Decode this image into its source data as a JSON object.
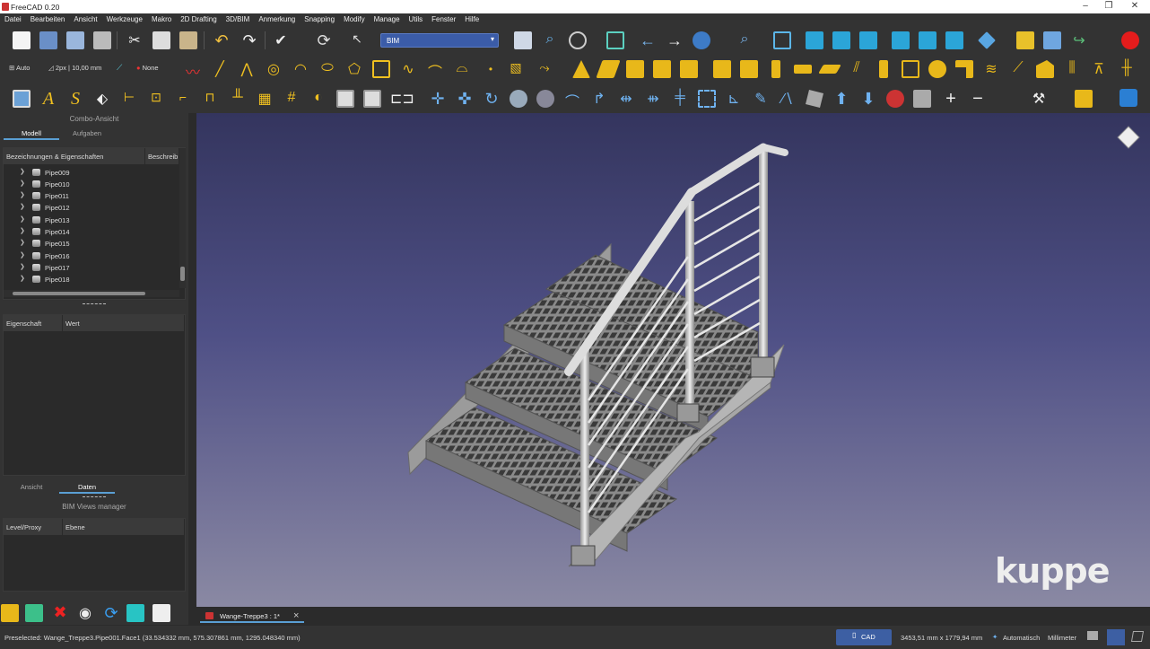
{
  "titlebar": {
    "title": "FreeCAD 0.20",
    "min": "–",
    "max": "❐",
    "close": "✕"
  },
  "menu": [
    "Datei",
    "Bearbeiten",
    "Ansicht",
    "Werkzeuge",
    "Makro",
    "2D Drafting",
    "3D/BIM",
    "Anmerkung",
    "Snapping",
    "Modify",
    "Manage",
    "Utils",
    "Fenster",
    "Hilfe"
  ],
  "toolbar1": {
    "workbench": "BIM"
  },
  "toolbar2": {
    "auto": "Auto",
    "linewidth": "2px | 10,00 mm",
    "none": "None"
  },
  "combo": {
    "title": "Combo-Ansicht",
    "tab_model": "Modell",
    "tab_tasks": "Aufgaben",
    "col_labels": "Bezeichnungen & Eigenschaften",
    "col_desc": "Beschreib",
    "tree": [
      "Pipe009",
      "Pipe010",
      "Pipe011",
      "Pipe012",
      "Pipe013",
      "Pipe014",
      "Pipe015",
      "Pipe016",
      "Pipe017",
      "Pipe018"
    ],
    "prop_col1": "Eigenschaft",
    "prop_col2": "Wert",
    "tab_view": "Ansicht",
    "tab_data": "Daten"
  },
  "bimviews": {
    "title": "BIM Views manager",
    "col1": "Level/Proxy",
    "col2": "Ebene"
  },
  "doctab": {
    "label": "Wange-Treppe3 : 1*",
    "close": "×"
  },
  "status": {
    "preselected": "Preselected: Wange_Treppe3.Pipe001.Face1 (33.534332 mm, 575.307861 mm, 1295.048340 mm)",
    "nav": "CAD",
    "dims": "3453,51 mm x 1779,94 mm",
    "auto": "Automatisch",
    "unit": "Millimeter"
  },
  "watermark": "kuppe"
}
